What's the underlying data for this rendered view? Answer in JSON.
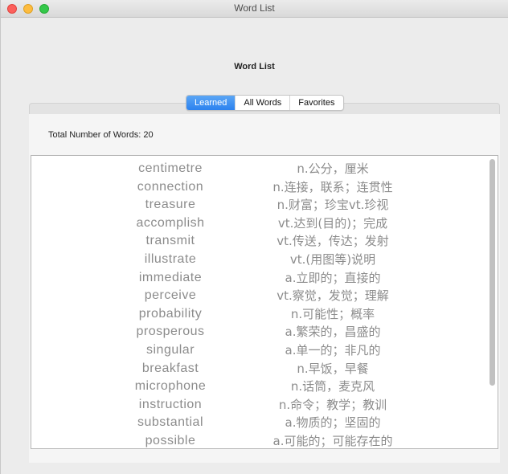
{
  "window": {
    "title": "Word List"
  },
  "page": {
    "title": "Word List"
  },
  "tabs": [
    {
      "label": "Learned",
      "active": true
    },
    {
      "label": "All Words",
      "active": false
    },
    {
      "label": "Favorites",
      "active": false
    }
  ],
  "total_label": "Total Number of Words: 20",
  "words": [
    {
      "word": "centimetre",
      "meaning": "n.公分，厘米"
    },
    {
      "word": "connection",
      "meaning": "n.连接，联系；连贯性"
    },
    {
      "word": "treasure",
      "meaning": "n.财富；珍宝vt.珍视"
    },
    {
      "word": "accomplish",
      "meaning": "vt.达到(目的)；完成"
    },
    {
      "word": "transmit",
      "meaning": "vt.传送，传达；发射"
    },
    {
      "word": "illustrate",
      "meaning": "vt.(用图等)说明"
    },
    {
      "word": "immediate",
      "meaning": "a.立即的；直接的"
    },
    {
      "word": "perceive",
      "meaning": "vt.察觉，发觉；理解"
    },
    {
      "word": "probability",
      "meaning": "n.可能性；概率"
    },
    {
      "word": "prosperous",
      "meaning": "a.繁荣的，昌盛的"
    },
    {
      "word": "singular",
      "meaning": "a.单一的；非凡的"
    },
    {
      "word": "breakfast",
      "meaning": "n.早饭，早餐"
    },
    {
      "word": "microphone",
      "meaning": "n.话筒，麦克风"
    },
    {
      "word": "instruction",
      "meaning": "n.命令；教学；教训"
    },
    {
      "word": "substantial",
      "meaning": "a.物质的；坚固的"
    },
    {
      "word": "possible",
      "meaning": "a.可能的；可能存在的"
    }
  ],
  "colors": {
    "tab_active": "#2c82ef",
    "list_text": "#8c8c8c",
    "close": "#fc605c",
    "minimize": "#fdbc40",
    "zoom": "#34c84a"
  }
}
